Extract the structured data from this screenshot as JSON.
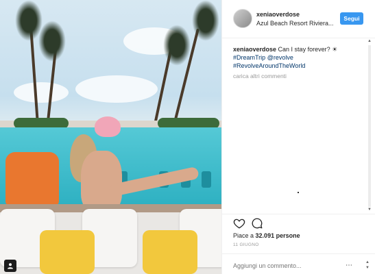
{
  "post": {
    "username": "xeniaoverdose",
    "location": "Azul Beach Resort Riviera...",
    "follow_label": "Segui",
    "caption_username": "xeniaoverdose",
    "caption_text": "Can I stay forever? ☀",
    "caption_tag1": "#DreamTrip",
    "caption_mention": "@revolve",
    "caption_tag2": "#RevolveAroundTheWorld",
    "load_more_comments": "carica altri commenti",
    "likes_prefix": "Piace a",
    "likes_count": "32.091",
    "likes_suffix": "persone",
    "date": "11 GIUGNO",
    "comment_placeholder": "Aggiungi un commento...",
    "options_symbol": "⋯"
  },
  "icons": {
    "heart": "heart-icon",
    "comment": "comment-icon",
    "user_tag": "user-tag-icon",
    "options": "more-options-icon"
  },
  "colors": {
    "accent": "#3897f0",
    "hashtag": "#003569",
    "muted": "#999999"
  }
}
